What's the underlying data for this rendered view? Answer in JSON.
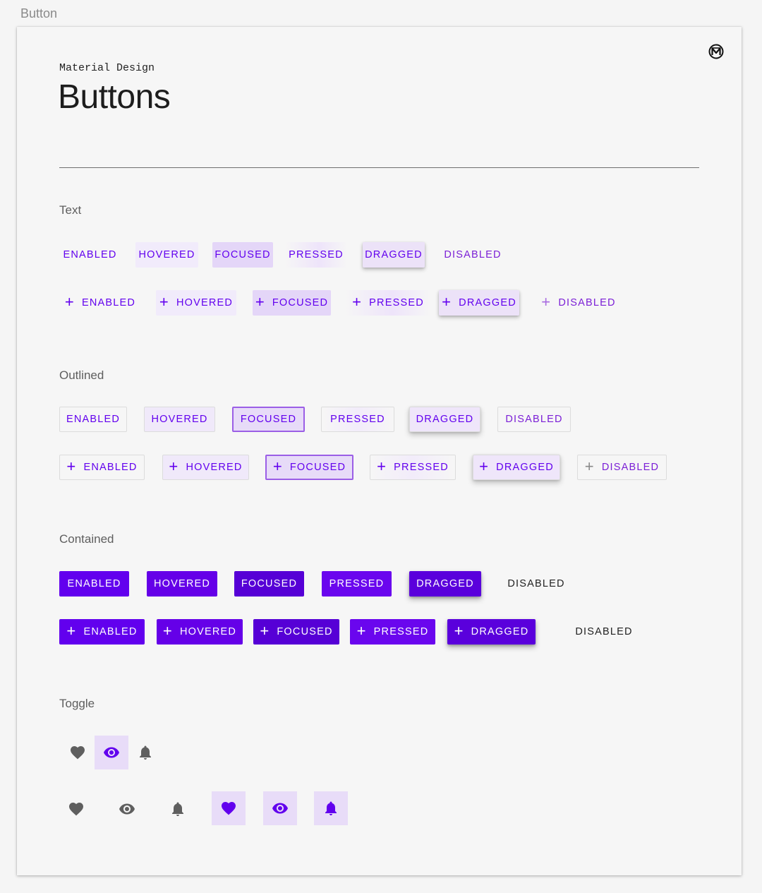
{
  "page_label": "Button",
  "header": {
    "subtitle": "Material Design",
    "title": "Buttons"
  },
  "colors": {
    "primary": "#6200ee",
    "icon_gray": "#5f5f5f",
    "toggle_selected_bg": "#e8dcf8"
  },
  "sections": {
    "text": {
      "title": "Text",
      "row1": [
        "ENABLED",
        "HOVERED",
        "FOCUSED",
        "PRESSED",
        "DRAGGED",
        "DISABLED"
      ],
      "row2": [
        "ENABLED",
        "HOVERED",
        "FOCUSED",
        "PRESSED",
        "DRAGGED",
        "DISABLED"
      ]
    },
    "outlined": {
      "title": "Outlined",
      "row1": [
        "ENABLED",
        "HOVERED",
        "FOCUSED",
        "PRESSED",
        "DRAGGED",
        "DISABLED"
      ],
      "row2": [
        "ENABLED",
        "HOVERED",
        "FOCUSED",
        "PRESSED",
        "DRAGGED",
        "DISABLED"
      ]
    },
    "contained": {
      "title": "Contained",
      "row1": [
        "ENABLED",
        "HOVERED",
        "FOCUSED",
        "PRESSED",
        "DRAGGED",
        "DISABLED"
      ],
      "row2": [
        "ENABLED",
        "HOVERED",
        "FOCUSED",
        "PRESSED",
        "DRAGGED",
        "DISABLED"
      ]
    },
    "toggle": {
      "title": "Toggle",
      "row1": [
        {
          "icon": "heart-icon",
          "selected": false
        },
        {
          "icon": "eye-icon",
          "selected": true
        },
        {
          "icon": "bell-icon",
          "selected": false
        }
      ],
      "row2": [
        {
          "icon": "heart-icon",
          "selected": false
        },
        {
          "icon": "eye-icon",
          "selected": false
        },
        {
          "icon": "bell-icon",
          "selected": false
        },
        {
          "icon": "heart-icon",
          "selected": true
        },
        {
          "icon": "eye-icon",
          "selected": true
        },
        {
          "icon": "bell-icon",
          "selected": true
        }
      ]
    }
  }
}
